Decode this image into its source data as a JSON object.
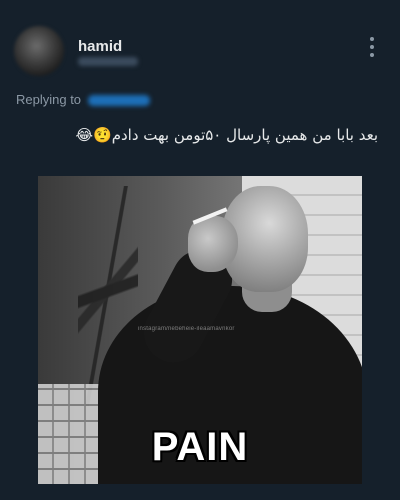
{
  "tweet": {
    "author": {
      "display_name": "hamid"
    },
    "replying_label": "Replying to",
    "text": "بعد بابا من همین پارسال ۵۰تومن بهت دادم🤨😂",
    "media": {
      "watermark": "instagram/nebeheie-ileaamavnkor",
      "caption": "PAIN"
    }
  },
  "colors": {
    "background": "#15202b",
    "primary_text": "#e7e9ea",
    "secondary_text": "#8b98a5",
    "link": "#1d9bf0"
  },
  "icons": [
    "more-vertical-icon"
  ]
}
